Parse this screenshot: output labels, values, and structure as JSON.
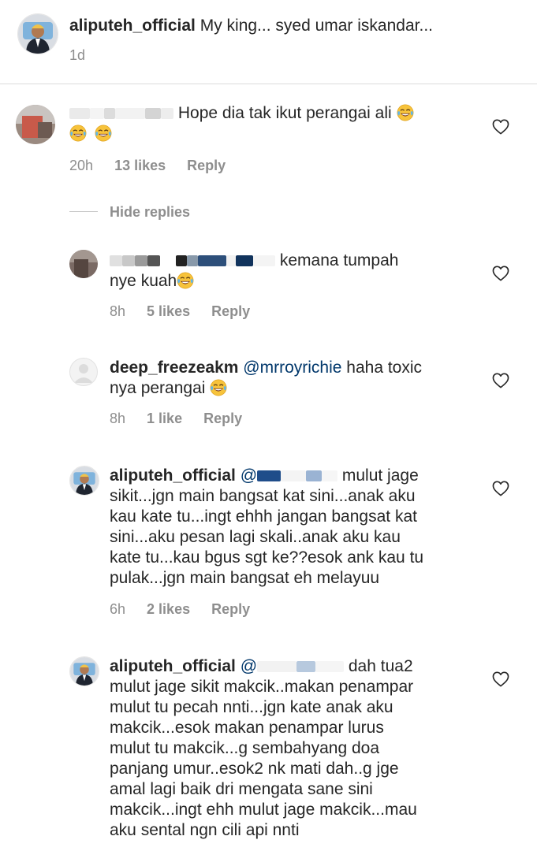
{
  "caption": {
    "username": "aliputeh_official",
    "text": "My king... syed umar iskandar...",
    "time": "1d"
  },
  "comment1": {
    "text": "Hope dia tak ikut perangai ali",
    "time": "20h",
    "likes": "13 likes",
    "reply": "Reply",
    "hide_replies": "Hide replies"
  },
  "reply1": {
    "text_a": "kemana tumpah",
    "text_b": "nye kuah",
    "time": "8h",
    "likes": "5 likes",
    "reply": "Reply"
  },
  "reply2": {
    "username": "deep_freezeakm",
    "mention": "@mrroyrichie",
    "text_a": "haha toxic",
    "text_b": "nya perangai",
    "time": "8h",
    "likes": "1 like",
    "reply": "Reply"
  },
  "reply3": {
    "username": "aliputeh_official",
    "mention": "@",
    "lines": [
      "mulut jage",
      "sikit...jgn main bangsat kat sini...anak aku",
      "kau kate tu...ingt ehhh jangan bangsat kat",
      "sini...aku pesan lagi skali..anak aku kau",
      "kate tu...kau bgus sgt ke??esok ank kau tu",
      "pulak...jgn main bangsat eh melayuu"
    ],
    "time": "6h",
    "likes": "2 likes",
    "reply": "Reply"
  },
  "reply4": {
    "username": "aliputeh_official",
    "mention": "@",
    "lines": [
      "dah tua2",
      "mulut jage sikit makcik..makan penampar",
      "mulut tu pecah nnti...jgn kate anak aku",
      "makcik...esok makan penampar lurus",
      "mulut tu makcik...g sembahyang doa",
      "panjang umur..esok2 nk mati dah..g jge",
      "amal lagi baik dri mengata sane sini",
      "makcik...ingt ehh mulut jage makcik...mau",
      "aku sental ngn cili api nnti"
    ]
  },
  "icons": {
    "heart": "heart-outline-icon",
    "emoji": "face-with-tears-of-joy-emoji"
  },
  "colors": {
    "text": "#262626",
    "muted": "#8e8e8e",
    "mention": "#00376b",
    "divider": "#dbdbdb"
  }
}
